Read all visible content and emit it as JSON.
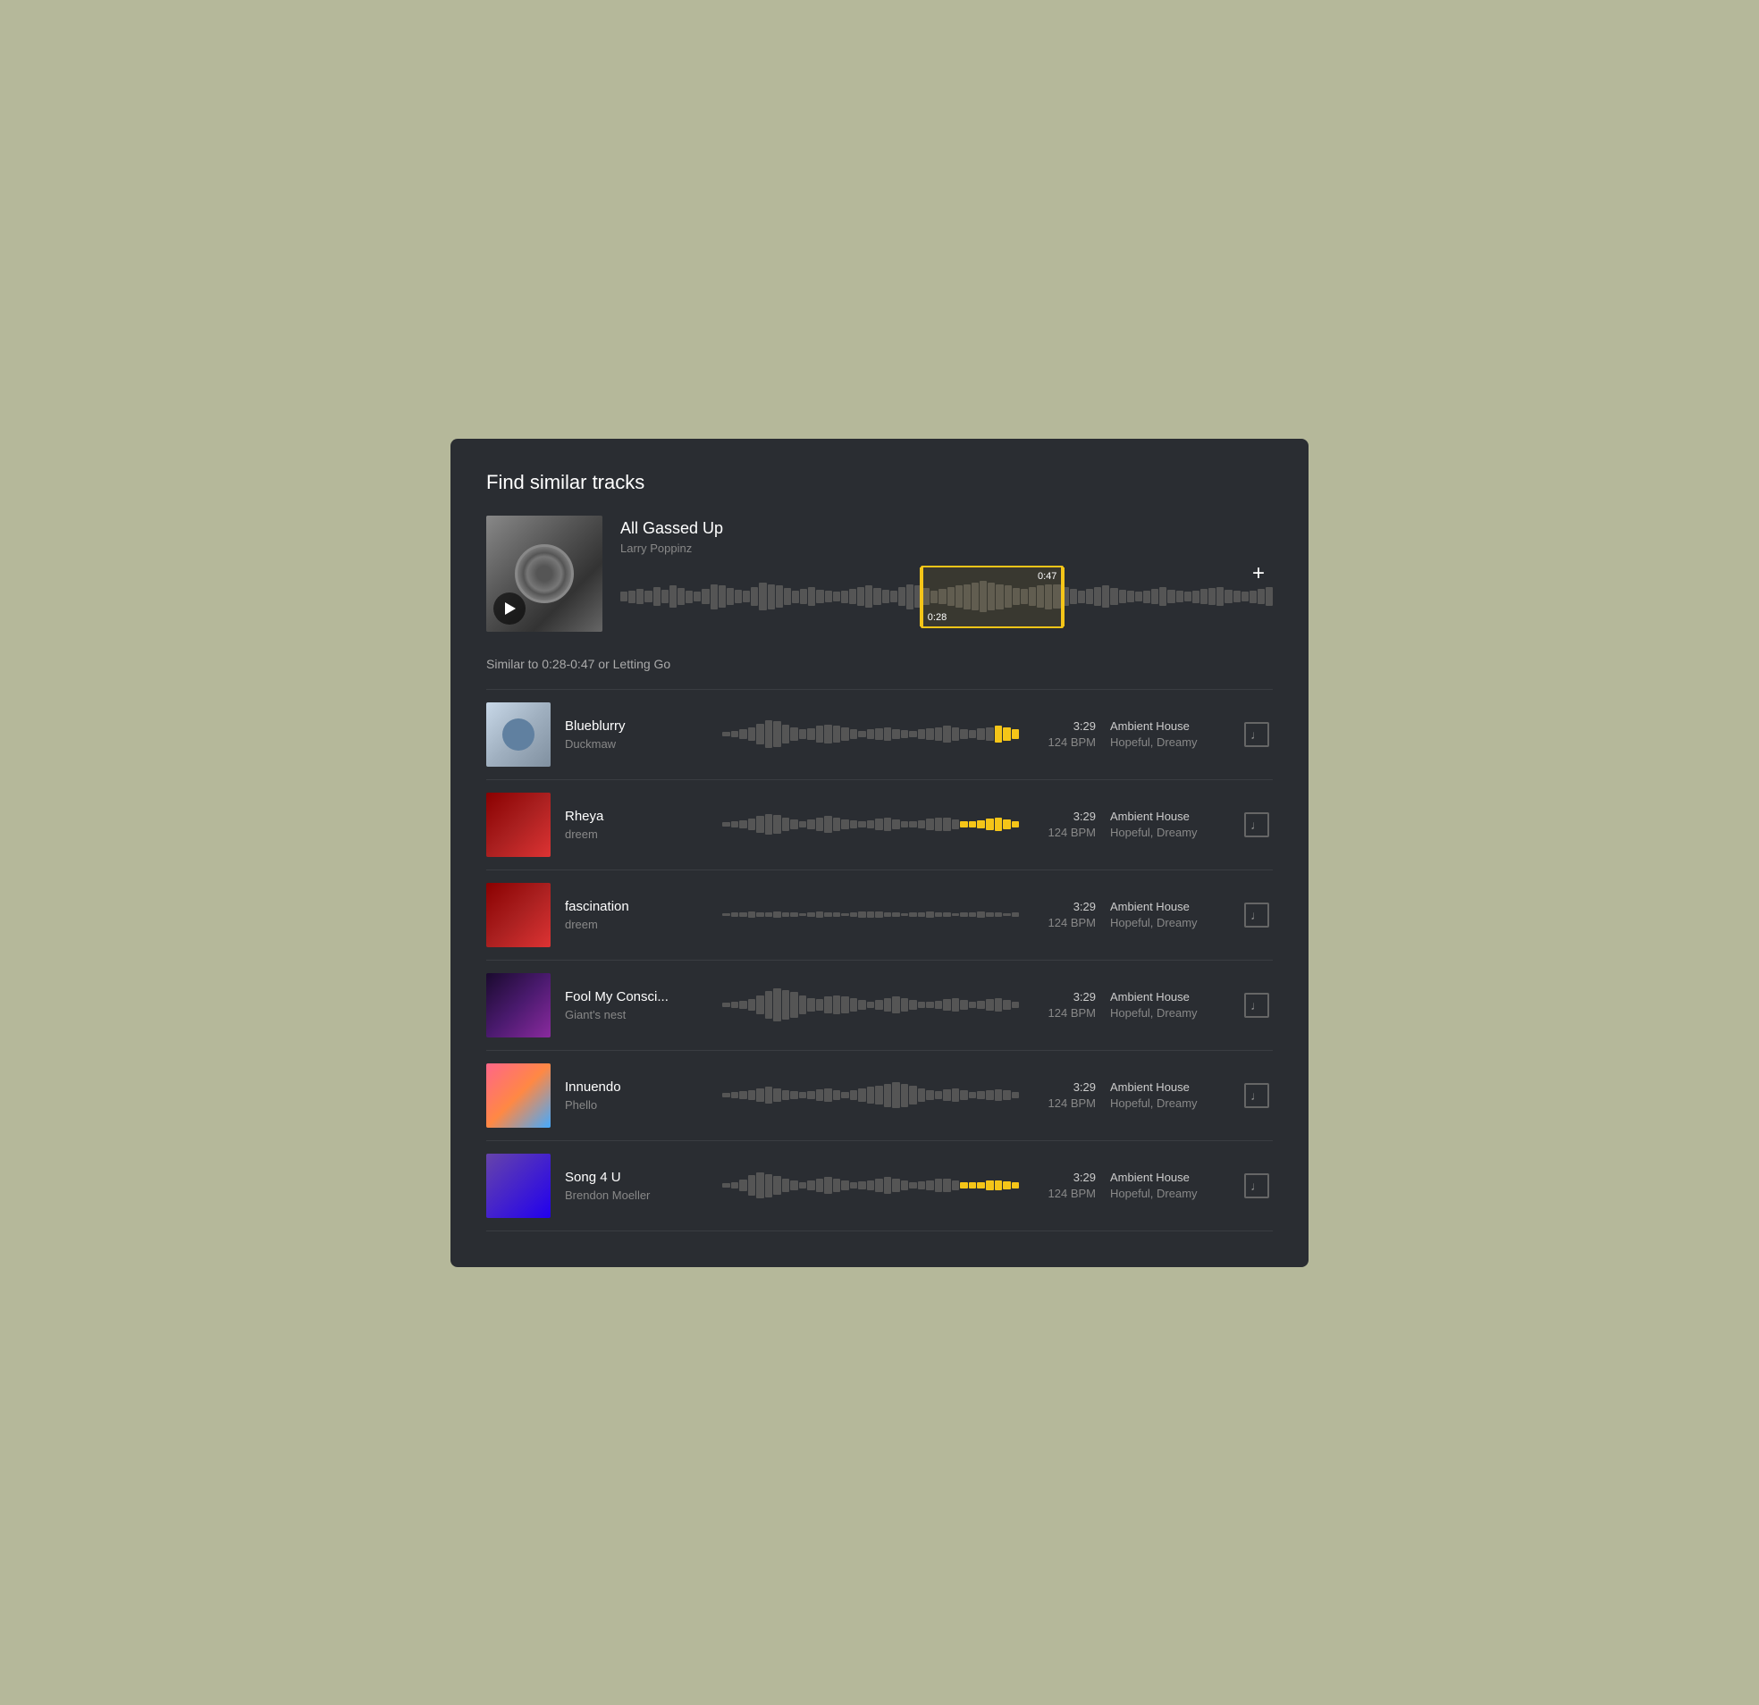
{
  "modal": {
    "title": "Find similar tracks"
  },
  "source_track": {
    "name": "All Gassed Up",
    "artist": "Larry Poppinz",
    "selection_start": "0:28",
    "selection_end": "0:47",
    "play_label": "Play"
  },
  "similar_label": "Similar to 0:28-0:47 or Letting Go",
  "add_button_label": "+",
  "tracks": [
    {
      "name": "Blueblurry",
      "artist": "Duckmaw",
      "duration": "3:29",
      "bpm": "124 BPM",
      "genre": "Ambient House",
      "mood": "Hopeful, Dreamy",
      "highlight_start": 32,
      "highlight_width": 18,
      "thumb_class": "thumb-1"
    },
    {
      "name": "Rheya",
      "artist": "dreem",
      "duration": "3:29",
      "bpm": "124 BPM",
      "genre": "Ambient House",
      "mood": "Hopeful, Dreamy",
      "highlight_start": 28,
      "highlight_width": 14,
      "thumb_class": "thumb-2"
    },
    {
      "name": "fascination",
      "artist": "dreem",
      "duration": "3:29",
      "bpm": "124 BPM",
      "genre": "Ambient House",
      "mood": "Hopeful, Dreamy",
      "highlight_start": 36,
      "highlight_width": 10,
      "thumb_class": "thumb-3"
    },
    {
      "name": "Fool My Consci...",
      "artist": "Giant's nest",
      "duration": "3:29",
      "bpm": "124 BPM",
      "genre": "Ambient House",
      "mood": "Hopeful, Dreamy",
      "highlight_start": 38,
      "highlight_width": 16,
      "thumb_class": "thumb-4"
    },
    {
      "name": "Innuendo",
      "artist": "Phello",
      "duration": "3:29",
      "bpm": "124 BPM",
      "genre": "Ambient House",
      "mood": "Hopeful, Dreamy",
      "highlight_start": 50,
      "highlight_width": 14,
      "thumb_class": "thumb-5"
    },
    {
      "name": "Song 4 U",
      "artist": "Brendon Moeller",
      "duration": "3:29",
      "bpm": "124 BPM",
      "genre": "Ambient House",
      "mood": "Hopeful, Dreamy",
      "highlight_start": 28,
      "highlight_width": 16,
      "thumb_class": "thumb-6"
    }
  ],
  "colors": {
    "highlight": "#f5c518",
    "background": "#2a2d32",
    "bar": "#555555",
    "text_primary": "#ffffff",
    "text_secondary": "#888888"
  }
}
